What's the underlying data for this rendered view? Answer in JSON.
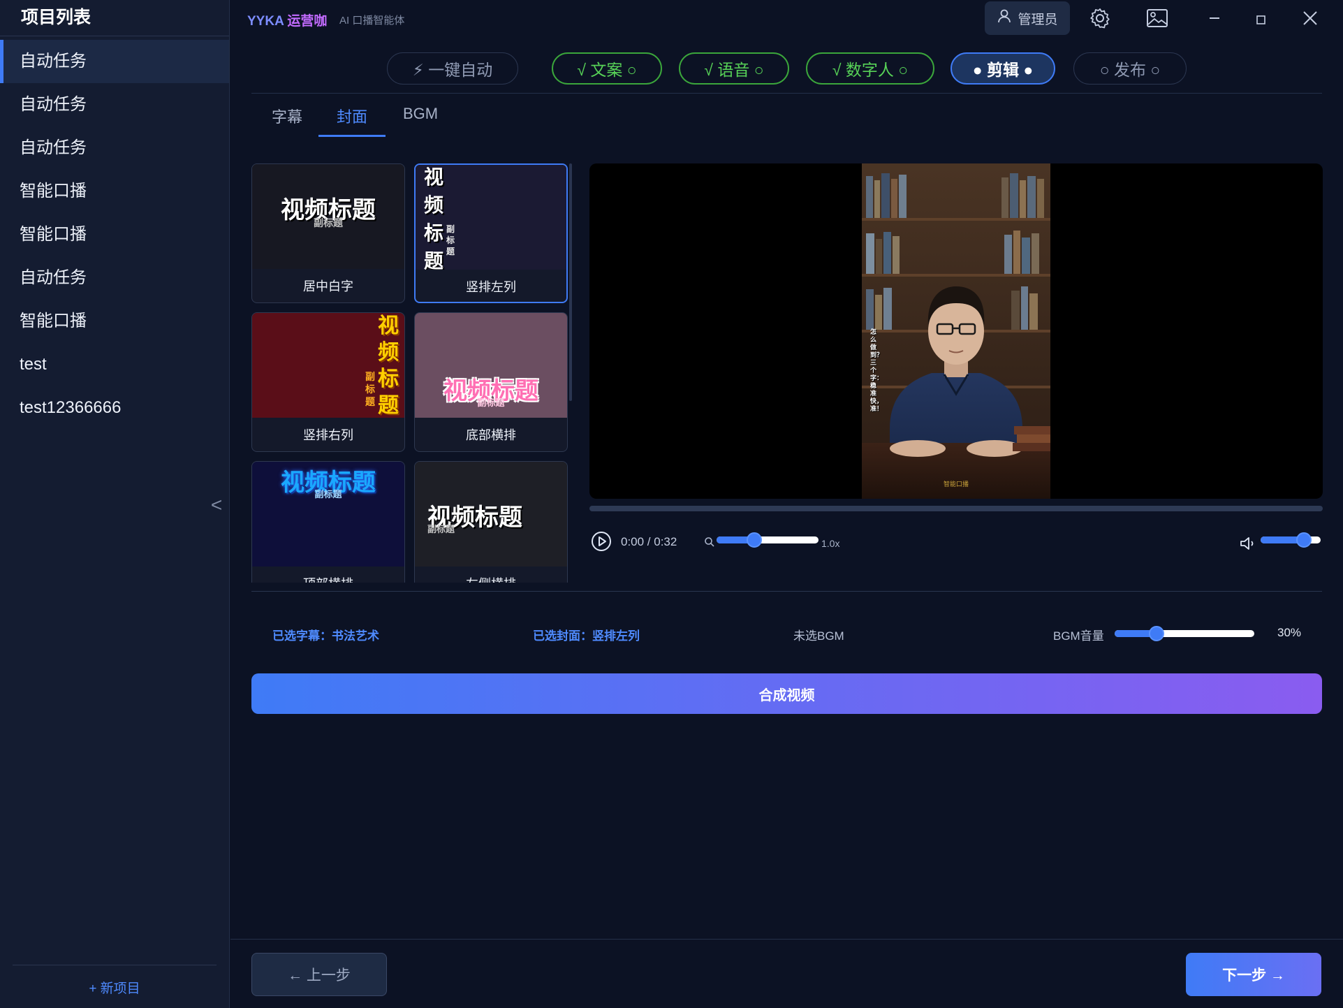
{
  "sidebar": {
    "title": "项目列表",
    "items": [
      {
        "label": "自动任务"
      },
      {
        "label": "自动任务"
      },
      {
        "label": "自动任务"
      },
      {
        "label": "智能口播"
      },
      {
        "label": "智能口播"
      },
      {
        "label": "自动任务"
      },
      {
        "label": "智能口播"
      },
      {
        "label": "test"
      },
      {
        "label": "test12366666"
      }
    ],
    "collapse_glyph": "<",
    "new_project": "+ 新项目"
  },
  "header": {
    "brand_part1": "YYKA",
    "brand_part2": "运营咖",
    "subtitle": "AI 口播智能体",
    "admin_label": "管理员",
    "icons": [
      "user-icon",
      "gear-icon",
      "image-icon",
      "minimize-icon",
      "maximize-icon",
      "close-icon"
    ]
  },
  "steps": [
    {
      "label": "⚡ 一键自动",
      "state": "idle"
    },
    {
      "label": "√ 文案 ○",
      "state": "done"
    },
    {
      "label": "√ 语音 ○",
      "state": "done"
    },
    {
      "label": "√ 数字人 ○",
      "state": "done"
    },
    {
      "label": "● 剪辑 ●",
      "state": "active"
    },
    {
      "label": "○ 发布 ○",
      "state": "idle"
    }
  ],
  "tabs": [
    {
      "label": "字幕"
    },
    {
      "label": "封面"
    },
    {
      "label": "BGM"
    }
  ],
  "templates": [
    {
      "label": "居中白字",
      "title": "视频标题",
      "sub": "副标题"
    },
    {
      "label": "竖排左列",
      "title": "视频标题",
      "sub": "副标题"
    },
    {
      "label": "竖排右列",
      "title": "视频标题",
      "sub": "副标题"
    },
    {
      "label": "底部横排",
      "title": "视频标题",
      "sub": "副标题"
    },
    {
      "label": "顶部横排",
      "title": "视频标题",
      "sub": "副标题"
    },
    {
      "label": "左侧横排",
      "title": "视频标题",
      "sub": "副标题"
    }
  ],
  "preview": {
    "caption": "怎么做到？三个字：稳准快，准！",
    "watermark": "智能口播"
  },
  "player": {
    "time": "0:00 / 0:32",
    "speed_label": "1.0x",
    "speed_fraction": 0.37,
    "volume_fraction": 0.72,
    "progress_fraction": 0.0
  },
  "summary": {
    "subtitle_selected": "已选字幕：书法艺术",
    "cover_selected": "已选封面：竖排左列",
    "bgm_status": "未选BGM",
    "bgm_volume_label": "BGM音量",
    "bgm_volume_value": "30%",
    "bgm_volume_fraction": 0.3
  },
  "compose_button": "合成视频",
  "nav": {
    "prev": "← 上一步",
    "next": "下一步 →"
  },
  "colors": {
    "accent": "#3f7bf6",
    "done_green": "#57d257",
    "purple": "#8a5cf0",
    "background": "#0c1224"
  }
}
